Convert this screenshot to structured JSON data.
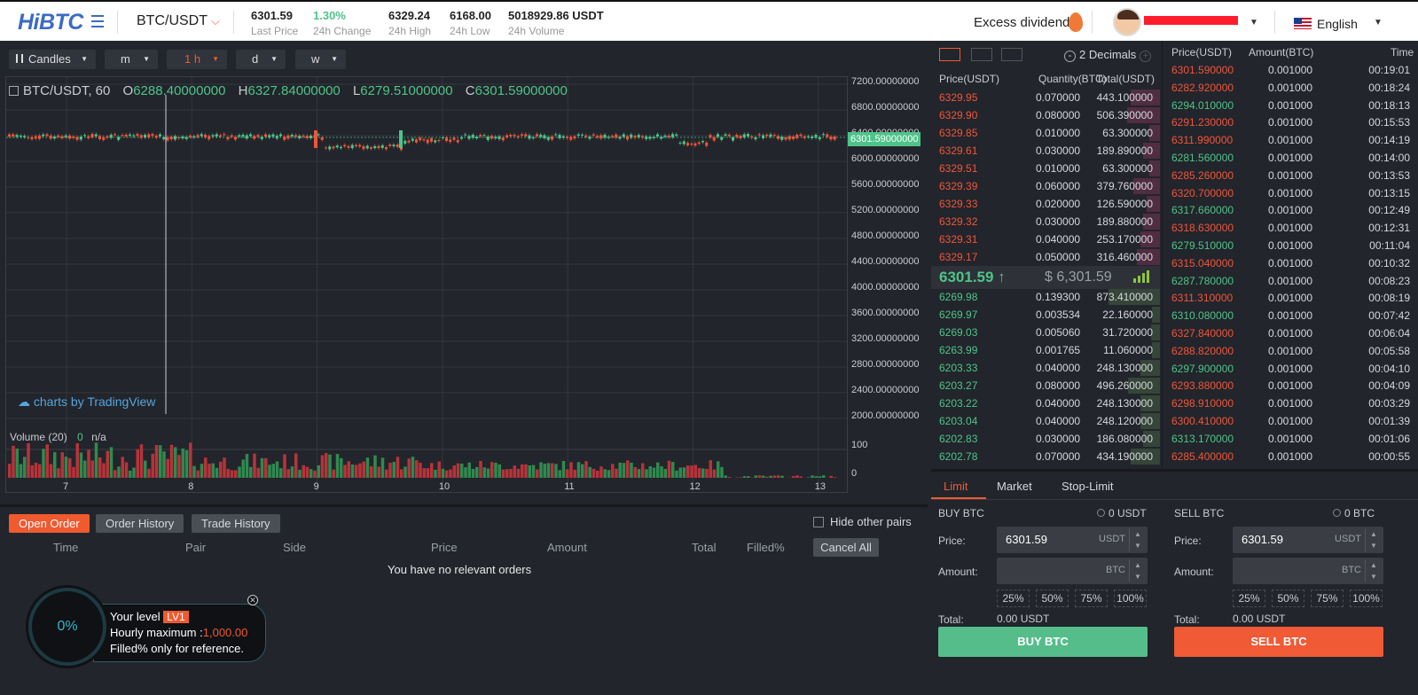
{
  "header": {
    "logo": "HiBTC",
    "pair": "BTC/USDT",
    "stats": [
      {
        "value": "6301.59",
        "label": "Last Price"
      },
      {
        "value": "1.30%",
        "label": "24h Change"
      },
      {
        "value": "6329.24",
        "label": "24h High"
      },
      {
        "value": "6168.00",
        "label": "24h Low"
      },
      {
        "value": "5018929.86 USDT",
        "label": "24h Volume"
      }
    ],
    "excess": "Excess dividend",
    "language": "English"
  },
  "chart": {
    "toolbar": [
      "Candles",
      "m",
      "1 h",
      "d",
      "w"
    ],
    "active_interval": "1 h",
    "legend": {
      "symbol": "BTC/USDT, 60",
      "o_label": "O",
      "o": "6288.40000000",
      "h_label": "H",
      "h": "6327.84000000",
      "l_label": "L",
      "l": "6279.51000000",
      "c_label": "C",
      "c": "6301.59000000"
    },
    "y_ticks": [
      "7200.00000000",
      "6800.00000000",
      "6400.00000000",
      "6000.00000000",
      "5600.00000000",
      "5200.00000000",
      "4800.00000000",
      "4400.00000000",
      "4000.00000000",
      "3600.00000000",
      "3200.00000000",
      "2800.00000000",
      "2400.00000000",
      "2000.00000000"
    ],
    "current_price_tag": "6301.59000000",
    "watermark": "charts by TradingView",
    "volume_label": "Volume (20)",
    "volume_value": "0",
    "volume_na": "n/a",
    "vol_ticks": [
      "100",
      "0"
    ],
    "x_ticks": [
      "7",
      "8",
      "9",
      "10",
      "11",
      "12",
      "13"
    ]
  },
  "orders": {
    "tabs": [
      "Open Order",
      "Order History",
      "Trade History"
    ],
    "hide_other": "Hide other pairs",
    "columns": [
      "Time",
      "Pair",
      "Side",
      "Price",
      "Amount",
      "Total",
      "Filled%"
    ],
    "cancel_all": "Cancel All",
    "empty": "You have no relevant orders"
  },
  "level": {
    "percent": "0%",
    "your_level": "Your level",
    "badge": "LV1",
    "hourly": "Hourly maximum :",
    "hourly_value": "1,000.00",
    "note": "Filled% only for reference."
  },
  "orderbook": {
    "decimals": "2 Decimals",
    "columns": [
      "Price(USDT)",
      "Quantity(BTC)",
      "Total(USDT)"
    ],
    "asks": [
      [
        "6329.95",
        "0.070000",
        "443.100000"
      ],
      [
        "6329.90",
        "0.080000",
        "506.390000"
      ],
      [
        "6329.85",
        "0.010000",
        "63.300000"
      ],
      [
        "6329.61",
        "0.030000",
        "189.890000"
      ],
      [
        "6329.51",
        "0.010000",
        "63.300000"
      ],
      [
        "6329.39",
        "0.060000",
        "379.760000"
      ],
      [
        "6329.33",
        "0.020000",
        "126.590000"
      ],
      [
        "6329.32",
        "0.030000",
        "189.880000"
      ],
      [
        "6329.31",
        "0.040000",
        "253.170000"
      ],
      [
        "6329.17",
        "0.050000",
        "316.460000"
      ]
    ],
    "mid_price": "6301.59 ↑",
    "mid_usd": "$ 6,301.59",
    "bids": [
      [
        "6269.98",
        "0.139300",
        "873.410000"
      ],
      [
        "6269.97",
        "0.003534",
        "22.160000"
      ],
      [
        "6269.03",
        "0.005060",
        "31.720000"
      ],
      [
        "6263.99",
        "0.001765",
        "11.060000"
      ],
      [
        "6203.33",
        "0.040000",
        "248.130000"
      ],
      [
        "6203.27",
        "0.080000",
        "496.260000"
      ],
      [
        "6203.22",
        "0.040000",
        "248.130000"
      ],
      [
        "6203.04",
        "0.040000",
        "248.120000"
      ],
      [
        "6202.83",
        "0.030000",
        "186.080000"
      ],
      [
        "6202.78",
        "0.070000",
        "434.190000"
      ]
    ]
  },
  "trades": {
    "columns": [
      "Price(USDT)",
      "Amount(BTC)",
      "Time"
    ],
    "rows": [
      [
        "6301.590000",
        "0.001000",
        "00:19:01",
        "sell"
      ],
      [
        "6282.920000",
        "0.001000",
        "00:18:24",
        "sell"
      ],
      [
        "6294.010000",
        "0.001000",
        "00:18:13",
        "buy"
      ],
      [
        "6291.230000",
        "0.001000",
        "00:15:53",
        "sell"
      ],
      [
        "6311.990000",
        "0.001000",
        "00:14:19",
        "sell"
      ],
      [
        "6281.560000",
        "0.001000",
        "00:14:00",
        "buy"
      ],
      [
        "6285.260000",
        "0.001000",
        "00:13:53",
        "sell"
      ],
      [
        "6320.700000",
        "0.001000",
        "00:13:15",
        "sell"
      ],
      [
        "6317.660000",
        "0.001000",
        "00:12:49",
        "buy"
      ],
      [
        "6318.630000",
        "0.001000",
        "00:12:31",
        "sell"
      ],
      [
        "6279.510000",
        "0.001000",
        "00:11:04",
        "buy"
      ],
      [
        "6315.040000",
        "0.001000",
        "00:10:32",
        "sell"
      ],
      [
        "6287.780000",
        "0.001000",
        "00:08:23",
        "buy"
      ],
      [
        "6311.310000",
        "0.001000",
        "00:08:19",
        "sell"
      ],
      [
        "6310.080000",
        "0.001000",
        "00:07:42",
        "buy"
      ],
      [
        "6327.840000",
        "0.001000",
        "00:06:04",
        "sell"
      ],
      [
        "6288.820000",
        "0.001000",
        "00:05:58",
        "sell"
      ],
      [
        "6297.900000",
        "0.001000",
        "00:04:10",
        "buy"
      ],
      [
        "6293.880000",
        "0.001000",
        "00:04:09",
        "sell"
      ],
      [
        "6298.910000",
        "0.001000",
        "00:03:29",
        "sell"
      ],
      [
        "6300.410000",
        "0.001000",
        "00:01:39",
        "sell"
      ],
      [
        "6313.170000",
        "0.001000",
        "00:01:06",
        "buy"
      ],
      [
        "6285.400000",
        "0.001000",
        "00:00:55",
        "sell"
      ]
    ]
  },
  "trade": {
    "tabs": [
      "Limit",
      "Market",
      "Stop-Limit"
    ],
    "buy": {
      "title": "BUY BTC",
      "balance": "0 USDT",
      "price_label": "Price:",
      "price": "6301.59",
      "price_unit": "USDT",
      "amount_label": "Amount:",
      "amount_unit": "BTC",
      "total_label": "Total:",
      "total": "0.00 USDT",
      "button": "BUY BTC"
    },
    "sell": {
      "title": "SELL BTC",
      "balance": "0 BTC",
      "price_label": "Price:",
      "price": "6301.59",
      "price_unit": "USDT",
      "amount_label": "Amount:",
      "amount_unit": "BTC",
      "total_label": "Total:",
      "total": "0.00 USDT",
      "button": "SELL BTC"
    },
    "percents": [
      "25%",
      "50%",
      "75%",
      "100%"
    ]
  },
  "colors": {
    "accent": "#ef5a2f",
    "up": "#4ec48a",
    "down": "#f0553b",
    "buy_button": "#55bd8a",
    "sell_button": "#f05a35"
  }
}
